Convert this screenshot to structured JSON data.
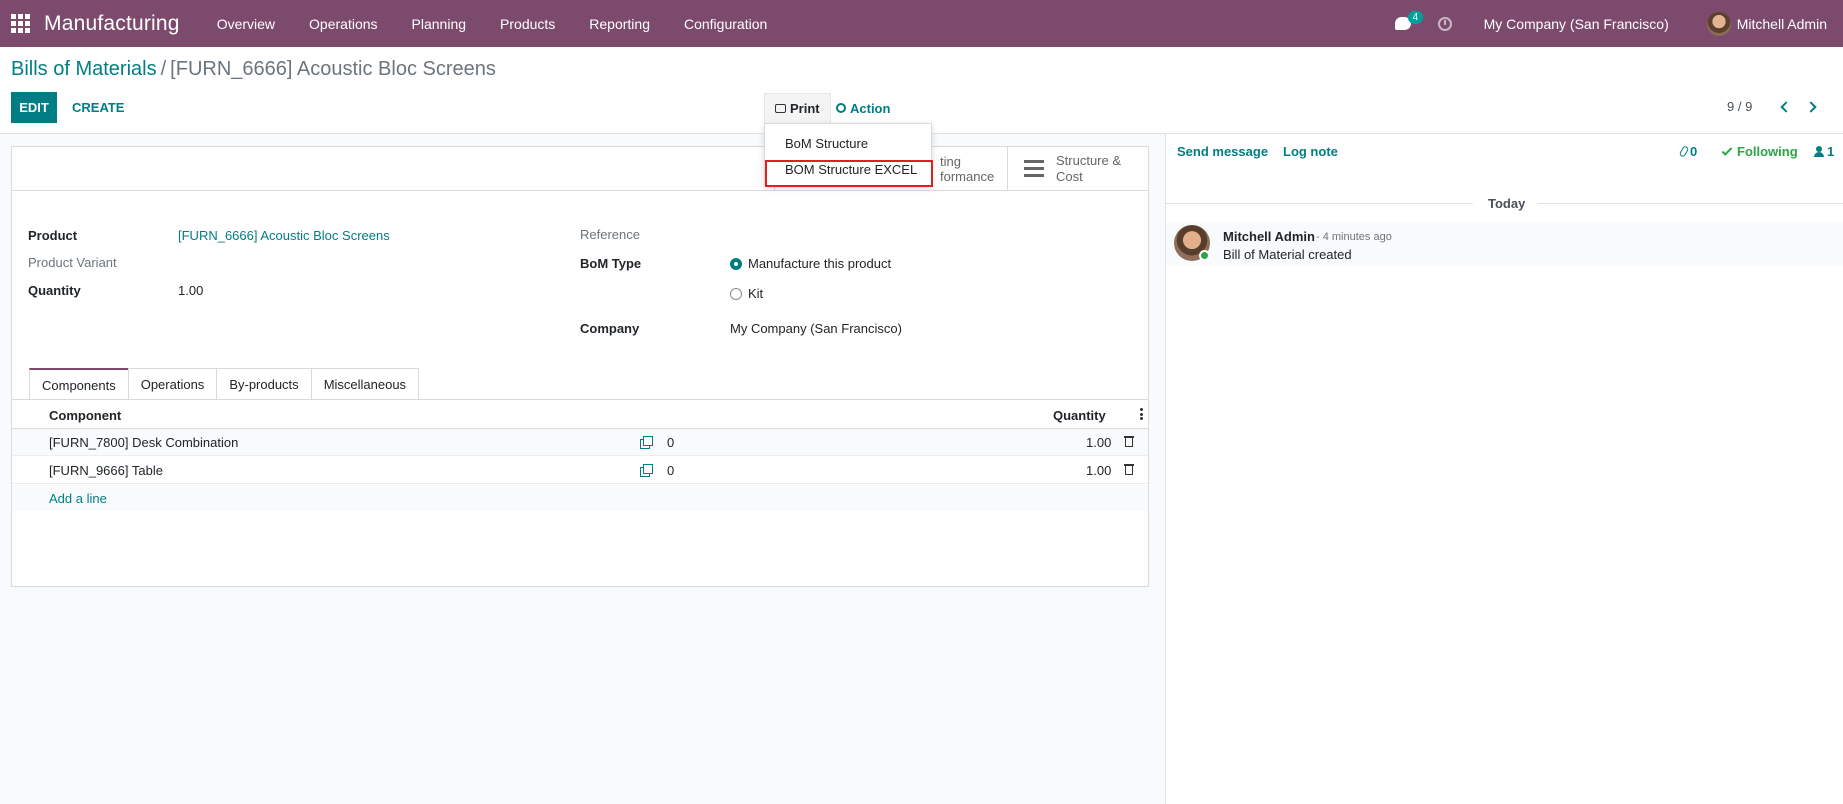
{
  "navbar": {
    "app_name": "Manufacturing",
    "menu": [
      "Overview",
      "Operations",
      "Planning",
      "Products",
      "Reporting",
      "Configuration"
    ],
    "chat_count": "4",
    "company": "My Company (San Francisco)",
    "user": "Mitchell Admin"
  },
  "breadcrumb": {
    "parent": "Bills of Materials",
    "separator": "/",
    "current": "[FURN_6666] Acoustic Bloc Screens"
  },
  "toolbar": {
    "edit": "EDIT",
    "create": "CREATE",
    "print": "Print",
    "action": "Action"
  },
  "print_menu": {
    "items": [
      "BoM Structure",
      "BOM Structure EXCEL"
    ],
    "highlighted_index": 1
  },
  "pager": {
    "value": "9 / 9"
  },
  "smart_buttons": {
    "routing_line1": "ting",
    "routing_line2": "formance",
    "structure_line1": "Structure &",
    "structure_line2": "Cost"
  },
  "form": {
    "product_label": "Product",
    "product_value": "[FURN_6666] Acoustic Bloc Screens",
    "variant_label": "Product Variant",
    "quantity_label": "Quantity",
    "quantity_value": "1.00",
    "reference_label": "Reference",
    "bom_type_label": "BoM Type",
    "bom_type_options": [
      "Manufacture this product",
      "Kit"
    ],
    "bom_type_selected": 0,
    "company_label": "Company",
    "company_value": "My Company (San Francisco)"
  },
  "tabs": [
    "Components",
    "Operations",
    "By-products",
    "Miscellaneous"
  ],
  "components_table": {
    "headers": {
      "component": "Component",
      "quantity": "Quantity"
    },
    "rows": [
      {
        "component": "[FURN_7800] Desk Combination",
        "count": "0",
        "quantity": "1.00"
      },
      {
        "component": "[FURN_9666] Table",
        "count": "0",
        "quantity": "1.00"
      }
    ],
    "add_line": "Add a line"
  },
  "chatter": {
    "send_message": "Send message",
    "log_note": "Log note",
    "attachments": "0",
    "following": "Following",
    "followers": "1",
    "date_separator": "Today",
    "messages": [
      {
        "author": "Mitchell Admin",
        "date": "- 4 minutes ago",
        "body": "Bill of Material created"
      }
    ]
  },
  "colors": {
    "navbar": "#7c4a6c",
    "primary": "#017e84",
    "highlight": "#e02020",
    "following": "#28a745"
  }
}
